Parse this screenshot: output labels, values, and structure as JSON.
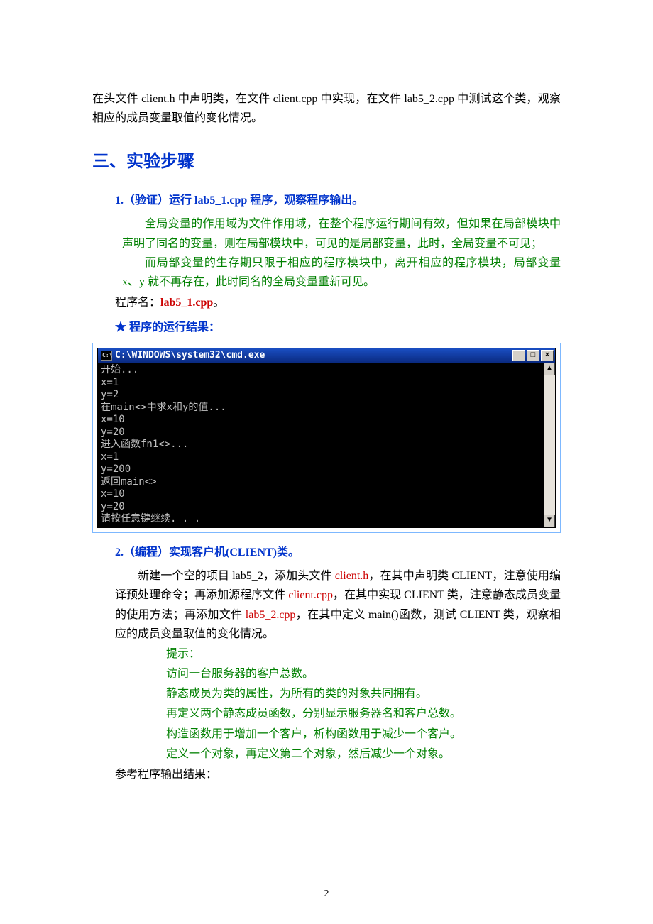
{
  "intro": "在头文件 client.h 中声明类，在文件 client.cpp 中实现，在文件 lab5_2.cpp 中测试这个类，观察相应的成员变量取值的变化情况。",
  "section_heading": "三、实验步骤",
  "step1": {
    "title": "1.（验证）运行 lab5_1.cpp 程序，观察程序输出。",
    "p1_a": "全局变量的作用域为文件作用域，在整个程序运行期间有效，但如果在局部模块中声明了同名的变量，则在局部模块中，可见的是局部变量，此时，全局变量不可见；",
    "p2_a": "而局部变量的生存期只限于相应的程序模块中，离开相应的程序模块，局部变量 x、y 就不再存在，此时同名的全局变量重新可见。",
    "prog_label": "程序名：",
    "prog_name": "lab5_1.cpp",
    "prog_tail": "。",
    "star_label": "★ 程序的运行结果："
  },
  "cmd": {
    "title": "C:\\WINDOWS\\system32\\cmd.exe",
    "min": "_",
    "max": "□",
    "close": "×",
    "up": "▲",
    "down": "▼",
    "lines": [
      "开始...",
      "x=1",
      "y=2",
      "在main<>中求x和y的值...",
      "x=10",
      "y=20",
      "进入函数fn1<>...",
      "x=1",
      "y=200",
      "返回main<>",
      "x=10",
      "y=20",
      "请按任意键继续. . ."
    ]
  },
  "step2": {
    "title": "2.（编程）实现客户机(CLIENT)类。",
    "body_a": "新建一个空的项目 lab5_2，添加头文件 ",
    "body_b": "client.h",
    "body_c": "，在其中声明类 CLIENT，注意使用编译预处理命令；再添加源程序文件 ",
    "body_d": "client.cpp",
    "body_e": "，在其中实现 CLIENT 类，注意静态成员变量的使用方法；再添加文件 ",
    "body_f": "lab5_2.cpp",
    "body_g": "，在其中定义 main()函数，测试 CLIENT 类，观察相应的成员变量取值的变化情况。",
    "hints_label": "提示：",
    "hints": [
      "访问一台服务器的客户总数。",
      "静态成员为类的属性，为所有的类的对象共同拥有。",
      "再定义两个静态成员函数，分别显示服务器名和客户总数。",
      "构造函数用于增加一个客户，析构函数用于减少一个客户。",
      "定义一个对象，再定义第二个对象，然后减少一个对象。"
    ],
    "ref": "参考程序输出结果："
  },
  "page_num": "2"
}
